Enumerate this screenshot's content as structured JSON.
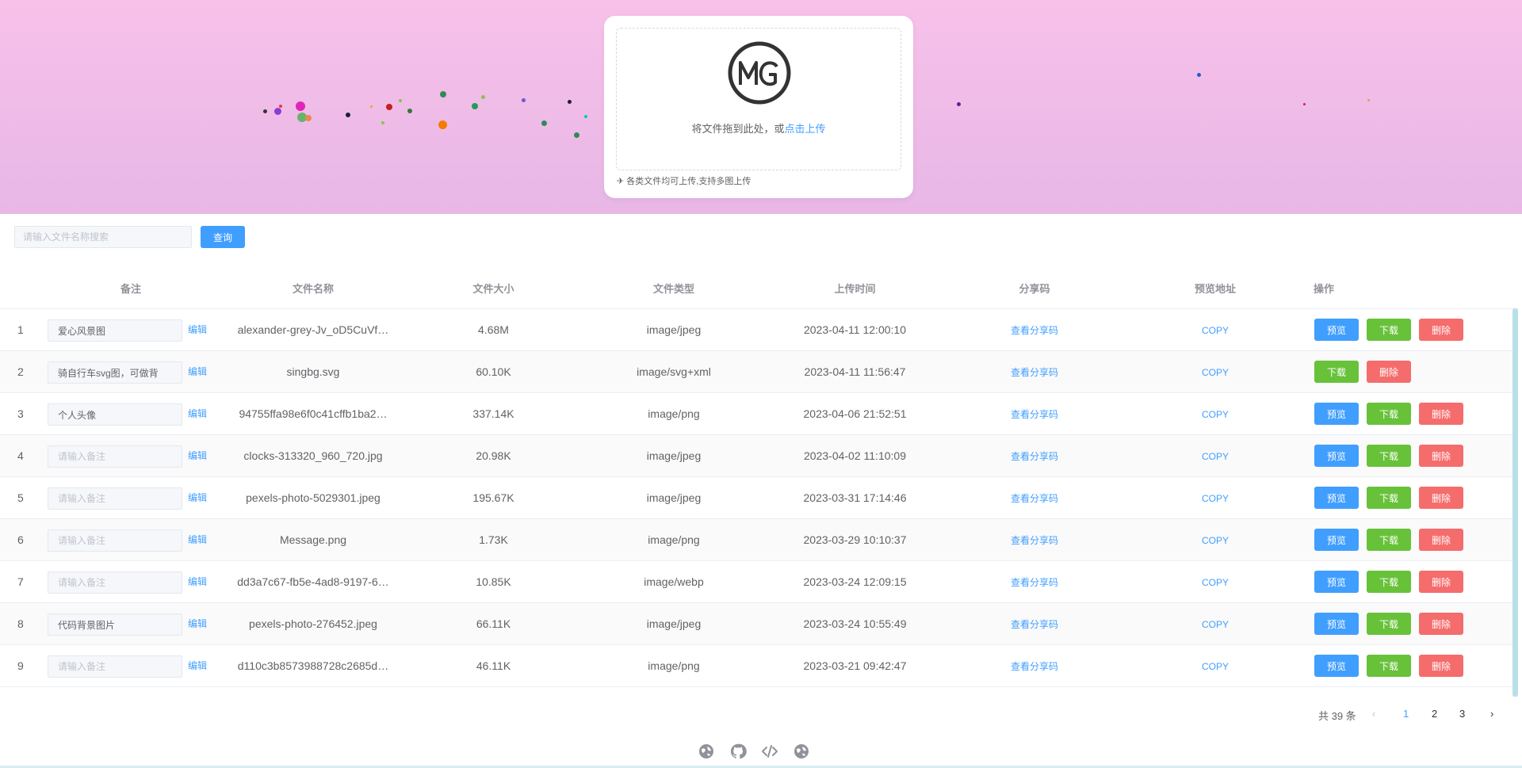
{
  "upload": {
    "logo_text": "MG",
    "drop_text": "将文件拖到此处，或",
    "drop_link": "点击上传",
    "tip": "各类文件均可上传,支持多图上传"
  },
  "search": {
    "placeholder": "请输入文件名称搜索",
    "button_label": "查询"
  },
  "table": {
    "headers": [
      "备注",
      "文件名称",
      "文件大小",
      "文件类型",
      "上传时间",
      "分享码",
      "预览地址",
      "操作"
    ],
    "note_placeholder": "请输入备注",
    "edit_label": "编辑",
    "share_label": "查看分享码",
    "copy_label": "COPY",
    "preview_label": "预览",
    "download_label": "下载",
    "delete_label": "删除",
    "rows": [
      {
        "index": "1",
        "note": "爱心风景图",
        "name": "alexander-grey-Jv_oD5CuVf…",
        "size": "4.68M",
        "type": "image/jpeg",
        "time": "2023-04-11 12:00:10",
        "has_preview": true
      },
      {
        "index": "2",
        "note": "骑自行车svg图，可做背",
        "name": "singbg.svg",
        "size": "60.10K",
        "type": "image/svg+xml",
        "time": "2023-04-11 11:56:47",
        "has_preview": false
      },
      {
        "index": "3",
        "note": "个人头像",
        "name": "94755ffa98e6f0c41cffb1ba2…",
        "size": "337.14K",
        "type": "image/png",
        "time": "2023-04-06 21:52:51",
        "has_preview": true
      },
      {
        "index": "4",
        "note": "",
        "name": "clocks-313320_960_720.jpg",
        "size": "20.98K",
        "type": "image/jpeg",
        "time": "2023-04-02 11:10:09",
        "has_preview": true
      },
      {
        "index": "5",
        "note": "",
        "name": "pexels-photo-5029301.jpeg",
        "size": "195.67K",
        "type": "image/jpeg",
        "time": "2023-03-31 17:14:46",
        "has_preview": true
      },
      {
        "index": "6",
        "note": "",
        "name": "Message.png",
        "size": "1.73K",
        "type": "image/png",
        "time": "2023-03-29 10:10:37",
        "has_preview": true
      },
      {
        "index": "7",
        "note": "",
        "name": "dd3a7c67-fb5e-4ad8-9197-6…",
        "size": "10.85K",
        "type": "image/webp",
        "time": "2023-03-24 12:09:15",
        "has_preview": true
      },
      {
        "index": "8",
        "note": "代码背景图片",
        "name": "pexels-photo-276452.jpeg",
        "size": "66.11K",
        "type": "image/jpeg",
        "time": "2023-03-24 10:55:49",
        "has_preview": true
      },
      {
        "index": "9",
        "note": "",
        "name": "d110c3b8573988728c2685d…",
        "size": "46.11K",
        "type": "image/png",
        "time": "2023-03-21 09:42:47",
        "has_preview": true
      }
    ]
  },
  "pagination": {
    "total": "共 39 条",
    "pages": [
      "1",
      "2",
      "3"
    ],
    "current": "1"
  },
  "footer": {
    "icons": [
      "globe-icon",
      "github-icon",
      "code-icon",
      "globe-icon"
    ]
  },
  "colors": {
    "primary": "#409eff",
    "success": "#67c23a",
    "danger": "#f56c6c",
    "banner_top": "#f7c1ea",
    "banner_bottom": "#e8b7e6"
  }
}
